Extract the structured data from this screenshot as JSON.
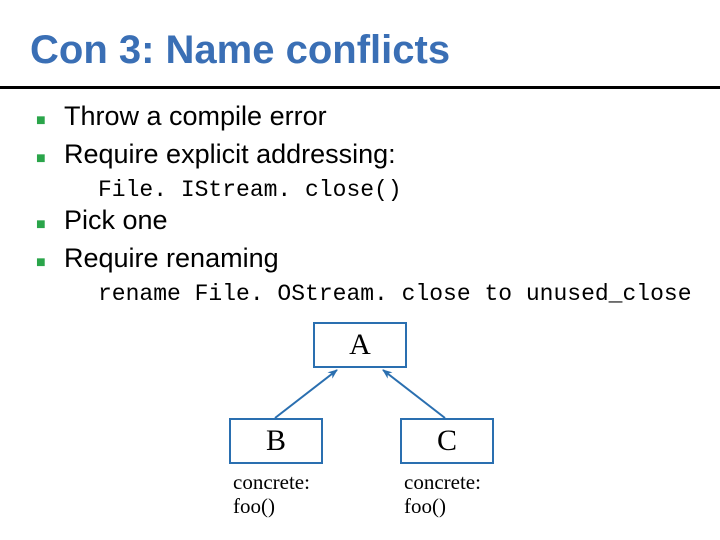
{
  "title": "Con 3: Name conflicts",
  "bullets": [
    {
      "text": "Throw a compile error"
    },
    {
      "text": "Require explicit addressing:",
      "code": "File. IStream. close()"
    },
    {
      "text": "Pick one"
    },
    {
      "text": "Require renaming",
      "code": "rename File. OStream. close to unused_close"
    }
  ],
  "diagram": {
    "nodes": {
      "a": {
        "label": "A"
      },
      "b": {
        "label": "B",
        "caption_l1": "concrete:",
        "caption_l2": "foo()"
      },
      "c": {
        "label": "C",
        "caption_l1": "concrete:",
        "caption_l2": "foo()"
      }
    }
  },
  "colors": {
    "title": "#3a6fb5",
    "bullet_mark": "#2aa54a",
    "node_border": "#2a6fb0",
    "arrow": "#2a6fb0"
  }
}
